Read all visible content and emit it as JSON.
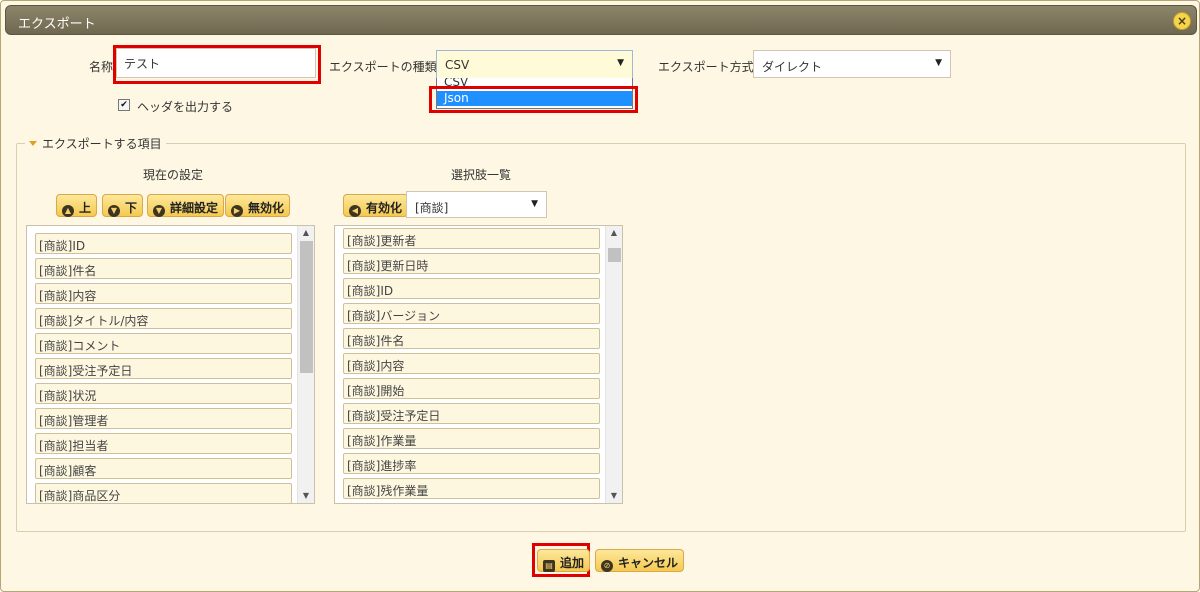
{
  "dialog": {
    "title": "エクスポート",
    "close_glyph": "×"
  },
  "form": {
    "name_label": "名称",
    "name_value": "テスト",
    "type_label": "エクスポートの種類",
    "type_value": "CSV",
    "type_options": [
      "CSV",
      "Json"
    ],
    "method_label": "エクスポート方式",
    "method_value": "ダイレクト",
    "header_checkbox_label": "ヘッダを出力する",
    "header_checked": true
  },
  "section": {
    "legend": "エクスポートする項目",
    "current_heading": "現在の設定",
    "choices_heading": "選択肢一覧",
    "buttons": {
      "up": "上",
      "down": "下",
      "detail": "詳細設定",
      "disable": "無効化",
      "enable": "有効化"
    },
    "category_value": "[商談]",
    "current_items": [
      "[商談]ID",
      "[商談]件名",
      "[商談]内容",
      "[商談]タイトル/内容",
      "[商談]コメント",
      "[商談]受注予定日",
      "[商談]状況",
      "[商談]管理者",
      "[商談]担当者",
      "[商談]顧客",
      "[商談]商品区分"
    ],
    "choice_items": [
      "[商談]更新者",
      "[商談]更新日時",
      "[商談]ID",
      "[商談]バージョン",
      "[商談]件名",
      "[商談]内容",
      "[商談]開始",
      "[商談]受注予定日",
      "[商談]作業量",
      "[商談]進捗率",
      "[商談]残作業量"
    ]
  },
  "footer": {
    "add_label": "追加",
    "cancel_label": "キャンセル"
  },
  "icons": {
    "up": "arrow-up-icon",
    "down": "arrow-down-icon",
    "detail": "arrow-down-icon",
    "disable": "arrow-right-icon",
    "enable": "arrow-left-icon",
    "add": "save-icon",
    "cancel": "cancel-icon"
  },
  "colors": {
    "accent": "#f5c94f",
    "highlight": "#e00000",
    "selection": "#1e90ff"
  }
}
